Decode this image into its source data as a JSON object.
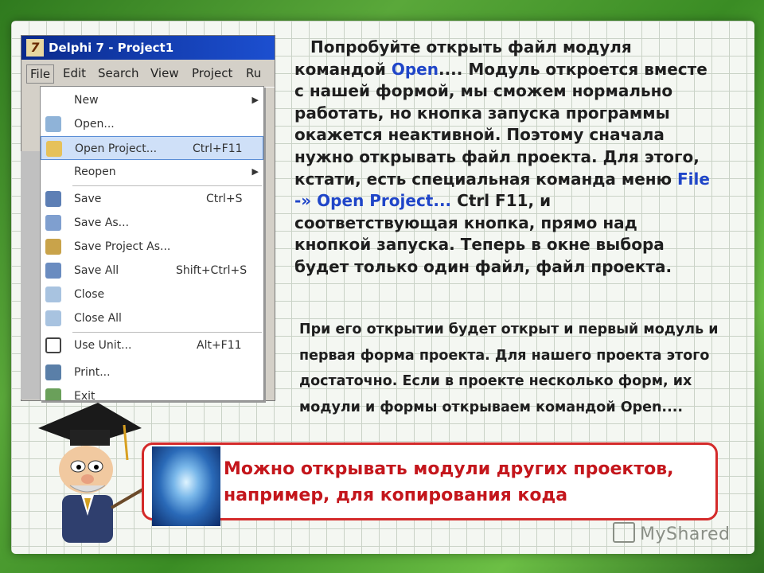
{
  "delphi": {
    "title": "Delphi 7 - Project1",
    "menu": [
      "File",
      "Edit",
      "Search",
      "View",
      "Project",
      "Ru"
    ],
    "file_menu": [
      {
        "label": "New",
        "shortcut": "",
        "submenu": true,
        "icon": "new-icon"
      },
      {
        "label": "Open...",
        "shortcut": "",
        "submenu": false,
        "icon": "open-folder-icon"
      },
      {
        "label": "Open Project...",
        "shortcut": "Ctrl+F11",
        "submenu": false,
        "icon": "open-project-icon",
        "selected": true
      },
      {
        "label": "Reopen",
        "shortcut": "",
        "submenu": true,
        "icon": ""
      },
      {
        "label": "Save",
        "shortcut": "Ctrl+S",
        "submenu": false,
        "icon": "save-icon"
      },
      {
        "label": "Save As...",
        "shortcut": "",
        "submenu": false,
        "icon": "save-as-icon"
      },
      {
        "label": "Save Project As...",
        "shortcut": "",
        "submenu": false,
        "icon": "save-project-icon"
      },
      {
        "label": "Save All",
        "shortcut": "Shift+Ctrl+S",
        "submenu": false,
        "icon": "save-all-icon"
      },
      {
        "label": "Close",
        "shortcut": "",
        "submenu": false,
        "icon": "close-icon"
      },
      {
        "label": "Close All",
        "shortcut": "",
        "submenu": false,
        "icon": "close-all-icon"
      },
      {
        "label": "Use Unit...",
        "shortcut": "Alt+F11",
        "submenu": false,
        "icon": "use-unit-icon"
      },
      {
        "label": "Print...",
        "shortcut": "",
        "submenu": false,
        "icon": "print-icon"
      },
      {
        "label": "Exit",
        "shortcut": "",
        "submenu": false,
        "icon": "exit-icon"
      }
    ]
  },
  "main_text": {
    "part1": "Попробуйте открыть файл модуля командой ",
    "open": "Open",
    "part2": ".... Модуль откроется вместе с нашей формой, мы сможем нормально работать, но кнопка запуска программы окажется неактивной. Поэтому сначала нужно открывать файл проекта. Для этого, кстати, есть специальная команда меню ",
    "file_open_project": "File -» Open Project...",
    "part3": "  Ctrl F11, и соответствующая кнопка, прямо над кнопкой запуска. Теперь в окне выбора будет только один файл, файл проекта."
  },
  "second_text": "При его открытии будет открыт и первый модуль и первая форма проекта. Для нашего проекта этого достаточно. Если в проекте несколько форм, их модули и формы открываем командой Open....",
  "callout": {
    "line1": "Можно открывать модули других проектов,",
    "line2": "например, для копирования кода"
  },
  "watermark": "MyShared",
  "colors": {
    "callout_border": "#d42a2a",
    "callout_text": "#c4161c",
    "highlight": "#1f45c8",
    "frame_green": "#3f8a2a"
  }
}
